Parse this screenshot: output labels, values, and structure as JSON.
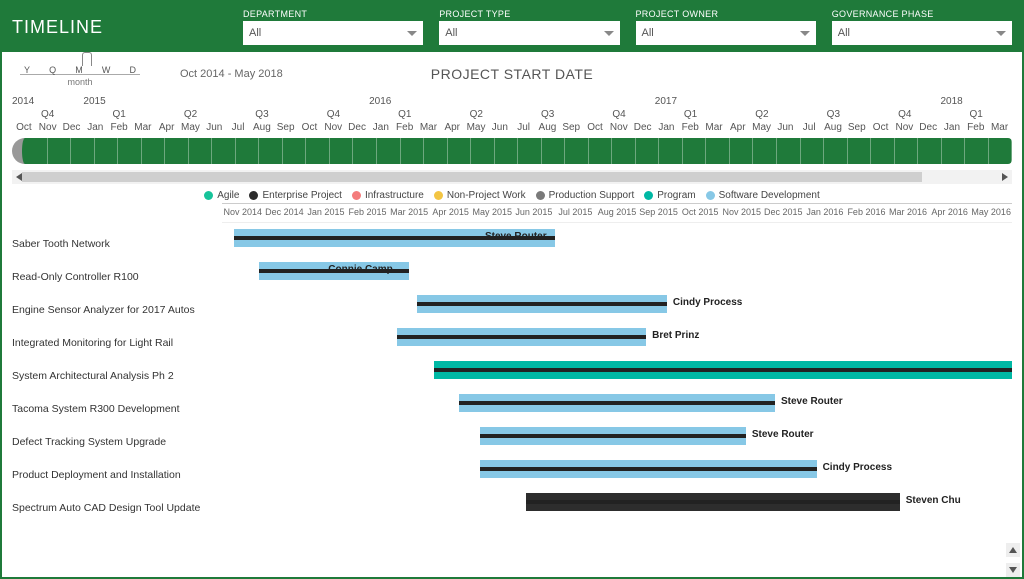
{
  "header": {
    "title": "TIMELINE",
    "filters": [
      {
        "label": "DEPARTMENT",
        "value": "All"
      },
      {
        "label": "PROJECT TYPE",
        "value": "All"
      },
      {
        "label": "PROJECT OWNER",
        "value": "All"
      },
      {
        "label": "GOVERNANCE PHASE",
        "value": "All"
      }
    ]
  },
  "zoom": {
    "ticks": [
      "Y",
      "Q",
      "M",
      "W",
      "D"
    ],
    "selected": "M",
    "caption": "month"
  },
  "range_text": "Oct 2014 - May 2018",
  "chart_title": "PROJECT START DATE",
  "timeline_axis": {
    "years": [
      "2014",
      "2015",
      "",
      "",
      "",
      "2016",
      "",
      "",
      "",
      "2017",
      "",
      "",
      "",
      "2018",
      ""
    ],
    "quarters": [
      "Q4",
      "Q1",
      "Q2",
      "Q3",
      "Q4",
      "Q1",
      "Q2",
      "Q3",
      "Q4",
      "Q1",
      "Q2",
      "Q3",
      "Q4",
      "Q1",
      ""
    ],
    "months": [
      "Oct",
      "Nov",
      "Dec",
      "Jan",
      "Feb",
      "Mar",
      "Apr",
      "May",
      "Jun",
      "Jul",
      "Aug",
      "Sep",
      "Oct",
      "Nov",
      "Dec",
      "Jan",
      "Feb",
      "Mar",
      "Apr",
      "May",
      "Jun",
      "Jul",
      "Aug",
      "Sep",
      "Oct",
      "Nov",
      "Dec",
      "Jan",
      "Feb",
      "Mar",
      "Apr",
      "May",
      "Jun",
      "Jul",
      "Aug",
      "Sep",
      "Oct",
      "Nov",
      "Dec",
      "Jan",
      "Feb",
      "Mar"
    ]
  },
  "legend": [
    {
      "name": "Agile",
      "color": "#17c39a"
    },
    {
      "name": "Enterprise Project",
      "color": "#2d2d2d"
    },
    {
      "name": "Infrastructure",
      "color": "#f47c7c"
    },
    {
      "name": "Non-Project Work",
      "color": "#f3c543"
    },
    {
      "name": "Production Support",
      "color": "#7a7a7a"
    },
    {
      "name": "Program",
      "color": "#00b8a4"
    },
    {
      "name": "Software Development",
      "color": "#87c8e6"
    }
  ],
  "gantt_months": [
    "Nov 2014",
    "Dec 2014",
    "Jan 2015",
    "Feb 2015",
    "Mar 2015",
    "Apr 2015",
    "May 2015",
    "Jun 2015",
    "Jul 2015",
    "Aug 2015",
    "Sep 2015",
    "Oct 2015",
    "Nov 2015",
    "Dec 2015",
    "Jan 2016",
    "Feb 2016",
    "Mar 2016",
    "Apr 2016",
    "May 2016"
  ],
  "chart_data": {
    "type": "bar",
    "title": "PROJECT START DATE",
    "x_unit": "month-index (0 = Nov 2014)",
    "categories": [
      "Saber Tooth Network",
      "Read-Only Controller R100",
      "Engine Sensor Analyzer for 2017 Autos",
      "Integrated Monitoring for Light Rail",
      "System Architectural Analysis Ph 2",
      "Tacoma System R300 Development",
      "Defect Tracking System Upgrade",
      "Product Deployment and Installation",
      "Spectrum Auto CAD Design Tool Update"
    ],
    "series": [
      {
        "name": "start_month_idx",
        "values": [
          0.3,
          0.9,
          4.7,
          4.2,
          5.1,
          5.7,
          6.2,
          6.2,
          7.3
        ]
      },
      {
        "name": "end_month_idx",
        "values": [
          8.0,
          4.5,
          10.7,
          10.2,
          19.0,
          13.3,
          12.6,
          14.3,
          16.3
        ]
      }
    ],
    "owners": [
      "Steve Router",
      "Connie Camp...",
      "Cindy Process",
      "Bret Prinz",
      "",
      "Steve Router",
      "Steve Router",
      "Cindy Process",
      "Steven Chu"
    ],
    "legend_category": [
      "Software Development",
      "Software Development",
      "Software Development",
      "Software Development",
      "Program",
      "Software Development",
      "Software Development",
      "Software Development",
      "Enterprise Project"
    ],
    "owner_label_inside": [
      true,
      true,
      false,
      false,
      false,
      false,
      false,
      false,
      false
    ]
  }
}
